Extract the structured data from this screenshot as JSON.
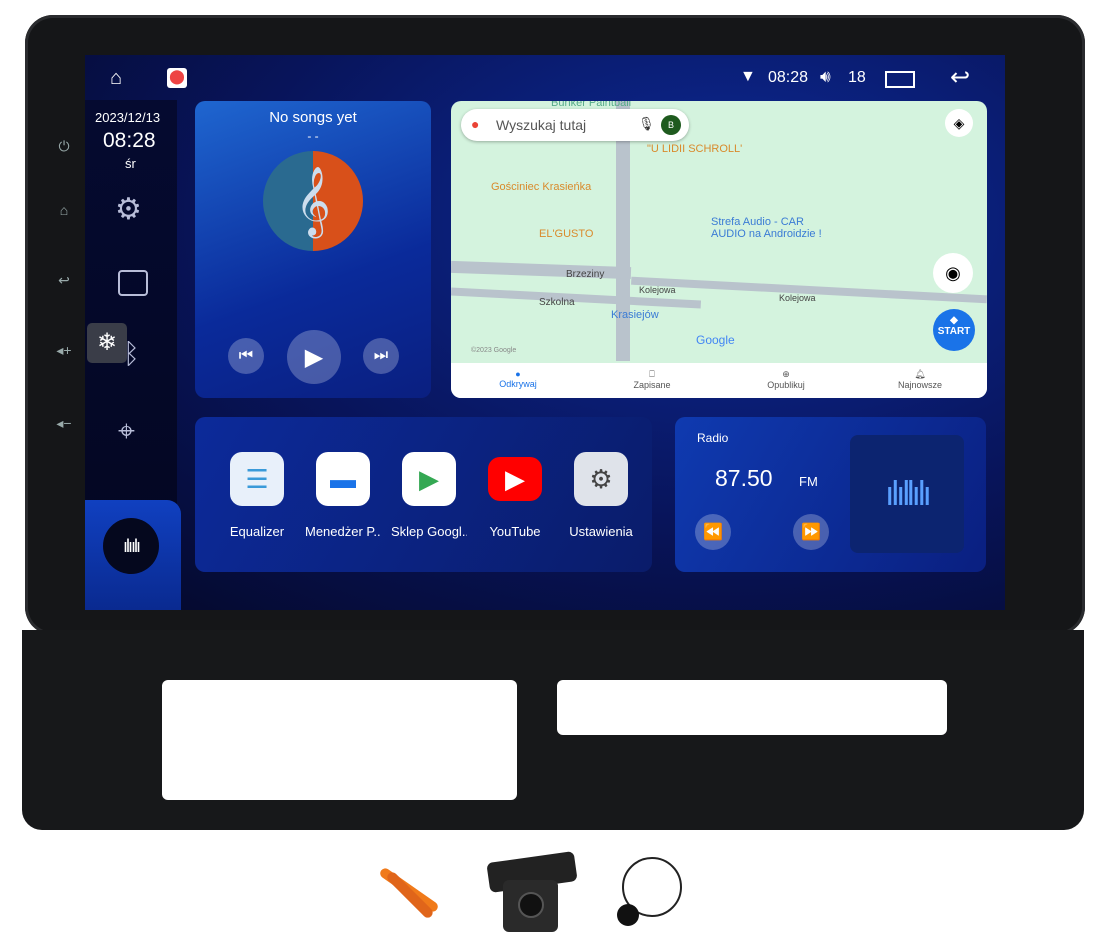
{
  "status_bar": {
    "time": "08:28",
    "volume": "18",
    "icons": [
      "home-outline-icon",
      "google-maps-icon",
      "wifi-icon",
      "volume-icon",
      "recents-icon",
      "back-icon"
    ]
  },
  "sidebar": {
    "date": "2023/12/13",
    "time": "08:28",
    "weekday": "śr",
    "items": [
      "gear-icon",
      "radio-icon",
      "bluetooth-icon",
      "location-pin-icon",
      "voice-icon"
    ],
    "ac_icon": "snowflake-icon"
  },
  "music": {
    "title": "No songs yet",
    "artist": "- -"
  },
  "map": {
    "search_placeholder": "Wyszukaj tutaj",
    "avatar": "B",
    "labels": [
      "Bunker Paintball",
      "\"U LIDII SCHROLL'",
      "Gościniec Krasieńka",
      "EL'GUSTO",
      "Strefa Audio - CAR AUDIO na Androidzie !",
      "Brzeziny",
      "Szkolna",
      "Kolejowa",
      "Kolejowa",
      "Krasiejów",
      "Google",
      "©2023 Google"
    ],
    "start": "START",
    "tabs": [
      "Odkrywaj",
      "Zapisane",
      "Opublikuj",
      "Najnowsze"
    ],
    "accent": "#1a73e8"
  },
  "apps": [
    {
      "label": "Equalizer"
    },
    {
      "label": "Menedżer P..."
    },
    {
      "label": "Sklep Googl..."
    },
    {
      "label": "YouTube"
    },
    {
      "label": "Ustawienia"
    }
  ],
  "radio": {
    "label": "Radio",
    "frequency": "87.50",
    "band": "FM"
  }
}
